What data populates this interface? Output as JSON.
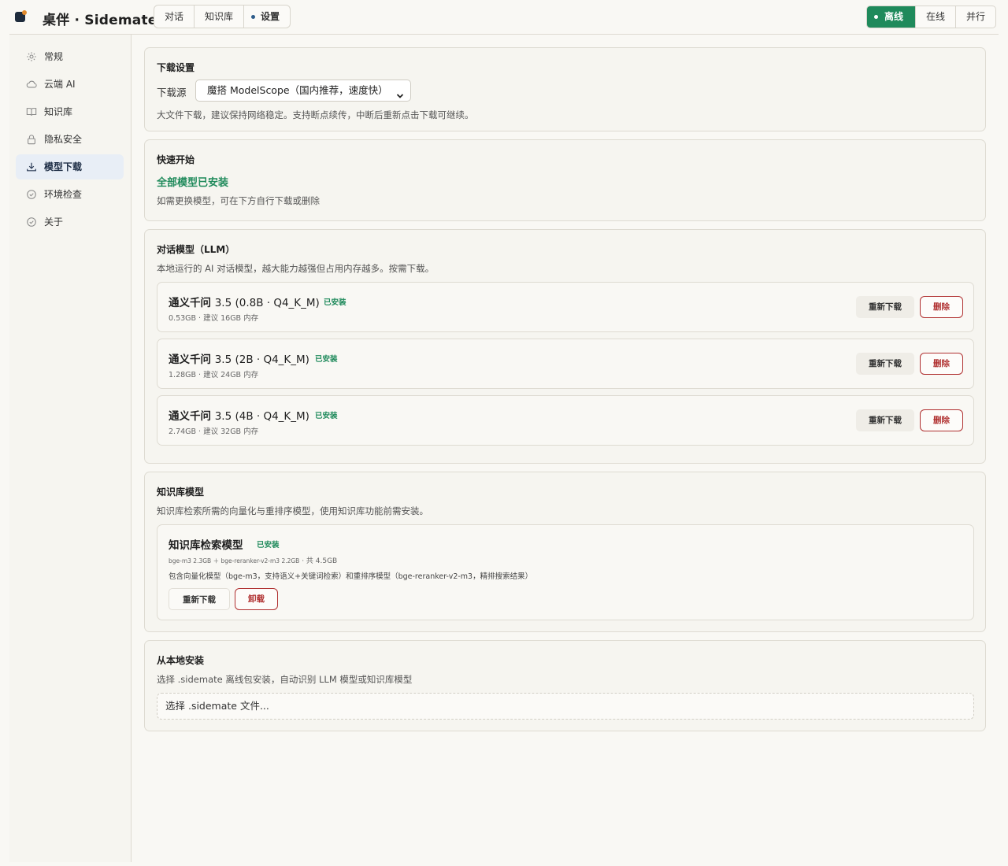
{
  "header": {
    "brand": "桌伴 · Sidemate",
    "nav_tabs": [
      {
        "label": "对话"
      },
      {
        "label": "知识库"
      },
      {
        "label": "设置"
      }
    ],
    "modes": [
      {
        "label": "离线"
      },
      {
        "label": "在线"
      },
      {
        "label": "并行"
      }
    ],
    "accent": "#1f8a5b"
  },
  "sidebar": {
    "items": [
      {
        "label": "常规",
        "icon": "gear-icon"
      },
      {
        "label": "云端 AI",
        "icon": "cloud-icon"
      },
      {
        "label": "知识库",
        "icon": "book-icon"
      },
      {
        "label": "隐私安全",
        "icon": "lock-icon"
      },
      {
        "label": "模型下载",
        "icon": "download-icon"
      },
      {
        "label": "环境检查",
        "icon": "check-circle-icon"
      },
      {
        "label": "关于",
        "icon": "check-circle-icon"
      }
    ]
  },
  "download_settings": {
    "title": "下载设置",
    "source_label": "下载源",
    "source_value": "魔搭 ModelScope（国内推荐，速度快）",
    "note": "大文件下载，建议保持网络稳定。支持断点续传，中断后重新点击下载可继续。"
  },
  "quick_start": {
    "title": "快速开始",
    "status": "全部模型已安装",
    "note": "如需更换模型，可在下方自行下载或删除"
  },
  "llm": {
    "title": "对话模型（LLM）",
    "desc": "本地运行的 AI 对话模型，越大能力越强但占用内存越多。按需下载。",
    "models": [
      {
        "name": "通义千问",
        "version": "3.5 (0.8B · Q4_K_M)",
        "badge": "已安装",
        "meta": "0.53GB · 建议 16GB 内存",
        "redownload": "重新下载",
        "delete": "删除"
      },
      {
        "name": "通义千问",
        "version": "3.5 (2B · Q4_K_M)",
        "badge": "已安装",
        "meta": "1.28GB · 建议 24GB 内存",
        "redownload": "重新下载",
        "delete": "删除"
      },
      {
        "name": "通义千问",
        "version": "3.5 (4B · Q4_K_M)",
        "badge": "已安装",
        "meta": "2.74GB · 建议 32GB 内存",
        "redownload": "重新下载",
        "delete": "删除"
      }
    ]
  },
  "kb_models": {
    "title": "知识库模型",
    "desc": "知识库检索所需的向量化与重排序模型，使用知识库功能前需安装。",
    "item": {
      "name": "知识库检索模型",
      "badge": "已安装",
      "sizes_small": "bge-m3 2.3GB ＋ bge-reranker-v2-m3 2.2GB",
      "sizes_total": " · 共 4.5GB",
      "detail": "包含向量化模型（bge-m3，支持语义+关键词检索）和重排序模型（bge-reranker-v2-m3，精排搜索结果）",
      "redownload": "重新下载",
      "uninstall": "卸载"
    }
  },
  "local_install": {
    "title": "从本地安装",
    "desc": "选择 .sidemate 离线包安装，自动识别 LLM 模型或知识库模型",
    "file_button": "选择 .sidemate 文件..."
  }
}
